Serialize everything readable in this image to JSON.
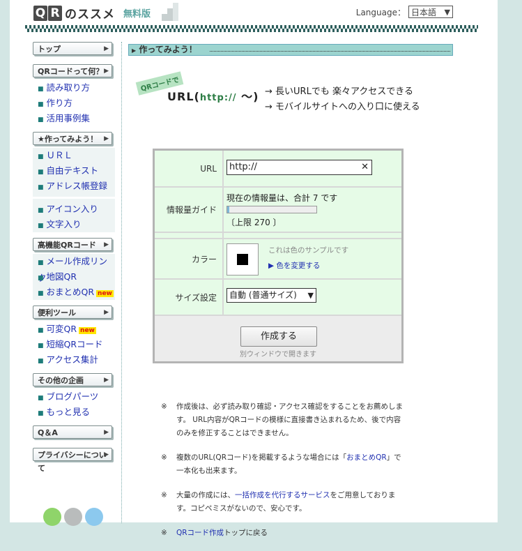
{
  "header": {
    "logo_box1": "Q",
    "logo_box2": "R",
    "logo_rest": "のススメ",
    "logo_free": "無料版",
    "language_label": "Language：",
    "language_value": "日本語"
  },
  "sidebar": {
    "top": "トップ",
    "what_qr": "QRコードって何？",
    "what_items": [
      "読み取り方",
      "作り方",
      "活用事例集"
    ],
    "make": "★作ってみよう！",
    "make_items_a": [
      "ＵＲＬ",
      "自由テキスト",
      "アドレス帳登録"
    ],
    "make_items_b": [
      "アイコン入り",
      "文字入り"
    ],
    "advanced": "高機能QRコード",
    "advanced_items": [
      "メール作成リンク",
      "地図QR",
      "おまとめQR"
    ],
    "tools": "便利ツール",
    "tools_items": [
      "可変QR",
      "短縮QRコード",
      "アクセス集計"
    ],
    "other": "その他の企画",
    "other_items": [
      "ブログパーツ",
      "もっと見る"
    ],
    "qa": "Q＆A",
    "privacy": "プライバシーについて",
    "new_badge": "new"
  },
  "main": {
    "section_title": "作ってみよう！",
    "hero_tag": "QRコードで",
    "hero_url_prefix": "URL(",
    "hero_http": "http://",
    "hero_url_suffix": " ～)",
    "hero_line1": "→ 長いURLでも 楽々アクセスできる",
    "hero_line2": "→ モバイルサイトへの入り口に使える"
  },
  "form": {
    "url_label": "URL",
    "url_value": "http://",
    "clear_glyph": "✕",
    "info_label": "情報量ガイド",
    "info_text": "現在の情報量は、合計 7 です",
    "info_level": 0.026,
    "info_limit": "〔上限 270 〕",
    "color_label": "カラー",
    "color_sample_text": "これは色のサンプルです",
    "color_change_link": "▶ 色を変更する",
    "sample_color": "#000000",
    "size_label": "サイズ設定",
    "size_value": "自動 (普通サイズ)",
    "make_button": "作成する",
    "make_sub": "別ウィンドウで開きます"
  },
  "notes": {
    "mark": "※",
    "n1": "作成後は、必ず読み取り確認・アクセス確認をすることをお薦めします。 URL内容がQRコードの模様に直接書き込まれるため、後で内容のみを修正することはできません。",
    "n2_a": "複数のURL(QRコード)を掲載するような場合には「",
    "n2_link": "おまとめQR",
    "n2_b": "」で一本化も出来ます。",
    "n3_a": "大量の作成には、",
    "n3_link": "一括作成を代行するサービス",
    "n3_b": "をご用意しております。コピペミスがないので、安心です。",
    "n4_link": "QRコード作成",
    "n4_b": "トップに戻る"
  },
  "colors": {
    "accent_teal": "#9cd4cf",
    "form_green": "#e6fbe7",
    "link_blue": "#2030b0"
  }
}
